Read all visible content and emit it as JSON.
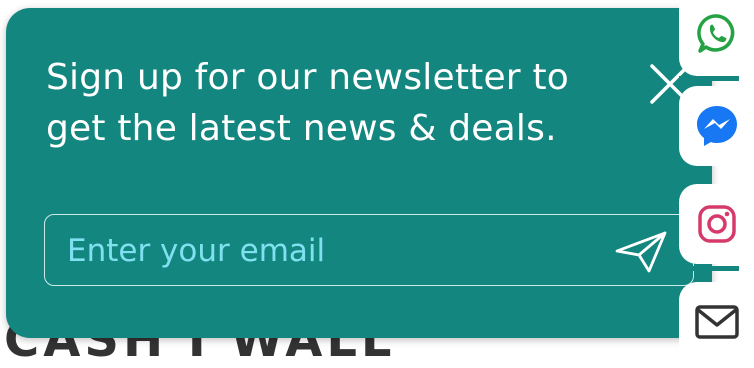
{
  "background": {
    "partial_text": "CASH I WALL"
  },
  "newsletter": {
    "headline": "Sign up for our newsletter to get the latest news & deals.",
    "email_placeholder": "Enter your email",
    "email_value": "",
    "colors": {
      "panel": "#148680",
      "text": "#ffffff",
      "placeholder": "#7fe0f0",
      "border": "#cfe9e6"
    },
    "close_icon": "close-icon",
    "send_icon": "send-icon"
  },
  "social_bar": {
    "items": [
      {
        "name": "whatsapp",
        "icon": "whatsapp-icon",
        "color": "#25a244"
      },
      {
        "name": "messenger",
        "icon": "messenger-icon",
        "color": "#1877f2"
      },
      {
        "name": "instagram",
        "icon": "instagram-icon",
        "color": "#d63a6a"
      },
      {
        "name": "email",
        "icon": "mail-icon",
        "color": "#333333"
      }
    ]
  }
}
